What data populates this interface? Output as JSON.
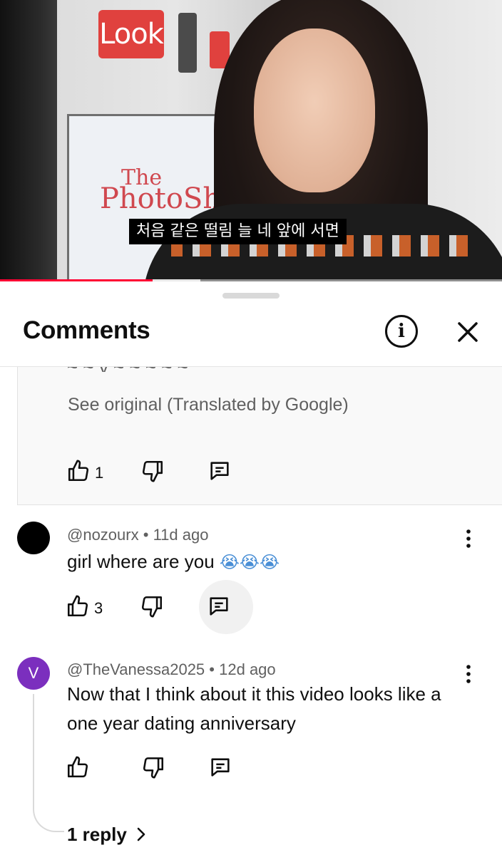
{
  "video": {
    "subtitle": "처음 같은 떨림 늘 네 앞에 서면",
    "sign_text": "Look",
    "booth_text_top": "The",
    "booth_text_main": "PhotoSho",
    "progress_fraction": 0.39,
    "buffer_fraction": 0.58,
    "progress_color": "#ff0033"
  },
  "sheet": {
    "title": "Comments",
    "info_icon": "info-circle-icon",
    "close_icon": "close-icon"
  },
  "translated_comment": {
    "partial_text": "~ ~ y ~ ~ ~ ~ ~",
    "see_original": "See original (Translated by Google)",
    "likes": "1"
  },
  "comments": [
    {
      "author": "@nozourx",
      "age": "11d ago",
      "avatar_color": "#000000",
      "text": "girl where are you",
      "emojis": "😭😭😭",
      "likes": "3"
    },
    {
      "author": "@TheVanessa2025",
      "age": "12d ago",
      "avatar_letter": "V",
      "avatar_color": "#7b2fbe",
      "text": "Now that I think about it this video looks like a one year dating anniversary",
      "likes": "",
      "replies_label": "1 reply"
    }
  ],
  "separator": "•"
}
